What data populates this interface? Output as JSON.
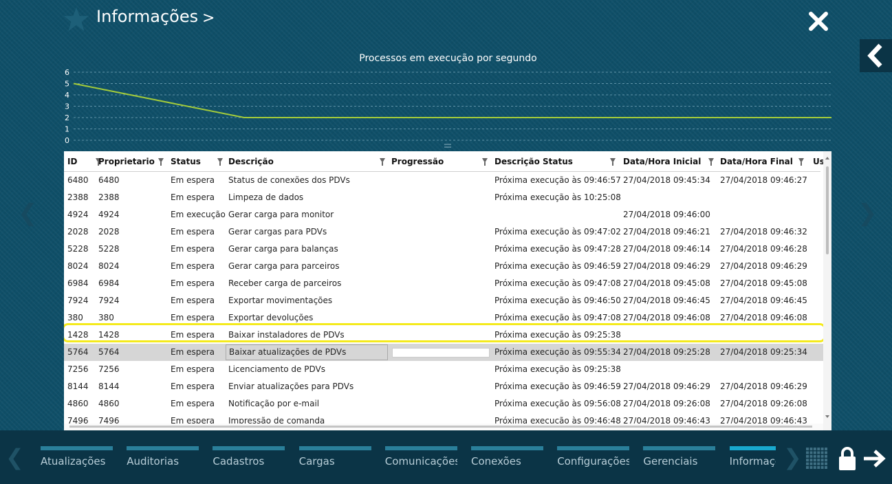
{
  "header": {
    "title": "Informações",
    "chevron": ">"
  },
  "chart_data": {
    "type": "line",
    "title": "Processos em execução por segundo",
    "y_ticks": [
      "6",
      "5",
      "4",
      "3",
      "2",
      "1",
      "0"
    ],
    "ylim": [
      0,
      6
    ],
    "grid": true,
    "series": [
      {
        "color": "#a4cc3a",
        "points": [
          [
            0,
            5
          ],
          [
            0.225,
            2
          ],
          [
            1,
            2
          ]
        ]
      }
    ]
  },
  "table": {
    "columns": [
      {
        "key": "id",
        "label": "ID"
      },
      {
        "key": "owner",
        "label": "Proprietario"
      },
      {
        "key": "status",
        "label": "Status"
      },
      {
        "key": "desc",
        "label": "Descrição"
      },
      {
        "key": "progress",
        "label": "Progressão"
      },
      {
        "key": "status_desc",
        "label": "Descrição Status"
      },
      {
        "key": "start",
        "label": "Data/Hora Inicial"
      },
      {
        "key": "end",
        "label": "Data/Hora Final"
      },
      {
        "key": "user",
        "label": "Us"
      }
    ],
    "selected_index": 10,
    "rows": [
      [
        "6480",
        "6480",
        "Em espera",
        "Status de conexões dos PDVs",
        "",
        "Próxima execução às 09:46:57",
        "27/04/2018 09:45:34",
        "27/04/2018 09:46:27"
      ],
      [
        "2388",
        "2388",
        "Em espera",
        "Limpeza de dados",
        "",
        "Próxima execução às 10:25:08",
        "",
        ""
      ],
      [
        "4924",
        "4924",
        "Em execução",
        "Gerar carga para monitor",
        "",
        "",
        "27/04/2018 09:46:00",
        ""
      ],
      [
        "2028",
        "2028",
        "Em espera",
        "Gerar cargas para PDVs",
        "",
        "Próxima execução às 09:47:02",
        "27/04/2018 09:46:21",
        "27/04/2018 09:46:32"
      ],
      [
        "5228",
        "5228",
        "Em espera",
        "Gerar carga para balanças",
        "",
        "Próxima execução às 09:47:28",
        "27/04/2018 09:46:14",
        "27/04/2018 09:46:28"
      ],
      [
        "8024",
        "8024",
        "Em espera",
        "Gerar carga para parceiros",
        "",
        "Próxima execução às 09:46:59",
        "27/04/2018 09:46:29",
        "27/04/2018 09:46:29"
      ],
      [
        "6984",
        "6984",
        "Em espera",
        "Receber carga de parceiros",
        "",
        "Próxima execução às 09:47:08",
        "27/04/2018 09:45:08",
        "27/04/2018 09:45:08"
      ],
      [
        "7924",
        "7924",
        "Em espera",
        "Exportar movimentações",
        "",
        "Próxima execução às 09:46:50",
        "27/04/2018 09:46:45",
        "27/04/2018 09:46:45"
      ],
      [
        "380",
        "380",
        "Em espera",
        "Exportar devoluções",
        "",
        "Próxima execução às 09:47:08",
        "27/04/2018 09:46:08",
        "27/04/2018 09:46:08"
      ],
      [
        "1428",
        "1428",
        "Em espera",
        "Baixar instaladores de PDVs",
        "",
        "Próxima execução às 09:25:38",
        "",
        ""
      ],
      [
        "5764",
        "5764",
        "Em espera",
        "Baixar atualizações de PDVs",
        "",
        "Próxima execução às 09:55:34",
        "27/04/2018 09:25:28",
        "27/04/2018 09:25:34"
      ],
      [
        "7256",
        "7256",
        "Em espera",
        "Licenciamento de PDVs",
        "",
        "Próxima execução às 09:25:38",
        "",
        ""
      ],
      [
        "8144",
        "8144",
        "Em espera",
        "Enviar atualizações para PDVs",
        "",
        "Próxima execução às 09:46:59",
        "27/04/2018 09:46:29",
        "27/04/2018 09:46:29"
      ],
      [
        "4860",
        "4860",
        "Em espera",
        "Notificação por e-mail",
        "",
        "Próxima execução às 09:56:08",
        "27/04/2018 09:26:08",
        "27/04/2018 09:26:08"
      ],
      [
        "7496",
        "7496",
        "Em espera",
        "Impressão de comanda",
        "",
        "Próxima execução às 09:46:48",
        "27/04/2018 09:46:43",
        "27/04/2018 09:46:43"
      ]
    ]
  },
  "bottom_bar": {
    "modules": [
      {
        "label": "Atualizações",
        "active": false
      },
      {
        "label": "Auditorias",
        "active": false
      },
      {
        "label": "Cadastros",
        "active": false
      },
      {
        "label": "Cargas",
        "active": false
      },
      {
        "label": "Comunicações",
        "active": false
      },
      {
        "label": "Conexões",
        "active": false
      },
      {
        "label": "Configurações",
        "active": false
      },
      {
        "label": "Gerenciais",
        "active": false
      },
      {
        "label": "Informações",
        "active": true
      }
    ]
  },
  "colors": {
    "background": "#0f4f68",
    "bottom_bar": "#0b3446",
    "highlight": "#f4ea1c",
    "line": "#a4cc3a",
    "active_tab": "#19a9cf"
  }
}
